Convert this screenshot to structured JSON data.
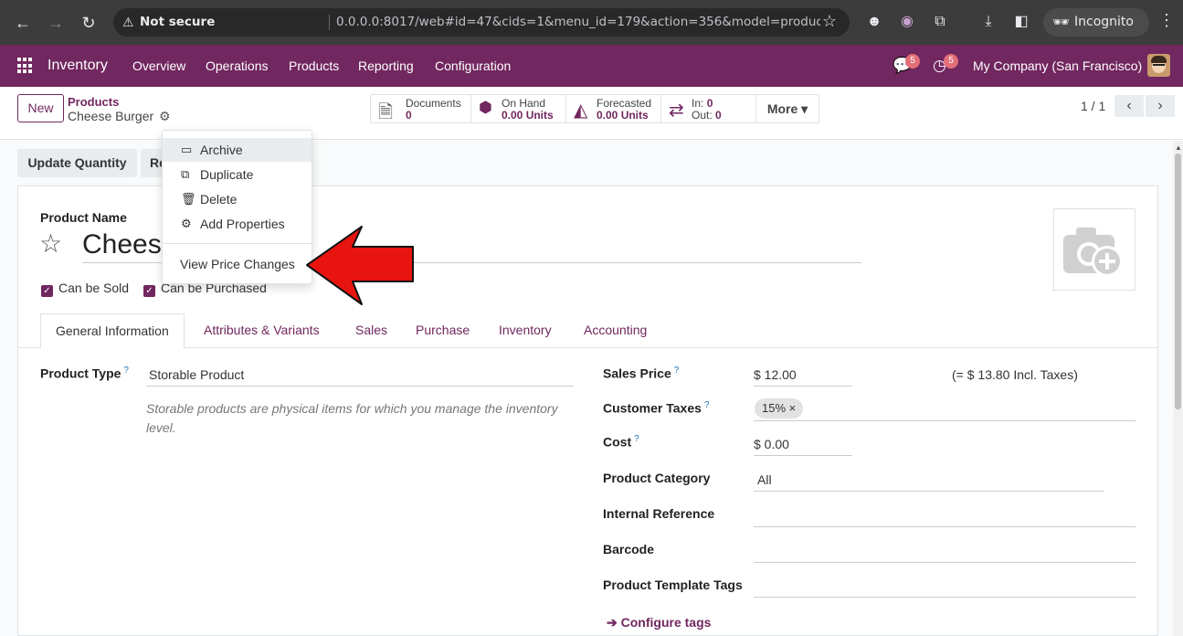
{
  "browser": {
    "security_label": "Not secure",
    "url": "0.0.0.0:8017/web#id=47&cids=1&menu_id=179&action=356&model=product.template&view_type=...",
    "incognito_label": "Incognito"
  },
  "navbar": {
    "app_name": "Inventory",
    "menus": [
      "Overview",
      "Operations",
      "Products",
      "Reporting",
      "Configuration"
    ],
    "messages_count": "5",
    "activities_count": "5",
    "company": "My Company (San Francisco)",
    "accent_color": "#71275f"
  },
  "control_panel": {
    "new_label": "New",
    "breadcrumb_parent": "Products",
    "breadcrumb_current": "Cheese Burger",
    "smart_buttons": [
      {
        "icon": "document-icon",
        "label": "Documents",
        "value": "0"
      },
      {
        "icon": "cubes-icon",
        "label": "On Hand",
        "value": "0.00 Units"
      },
      {
        "icon": "area-chart-icon",
        "label": "Forecasted",
        "value": "0.00 Units"
      },
      {
        "icon": "exchange-icon",
        "label_in": "In:",
        "value_in": "0",
        "label_out": "Out:",
        "value_out": "0"
      }
    ],
    "more_label": "More",
    "pager": "1 / 1"
  },
  "actions": {
    "update_quantity": "Update Quantity",
    "replenish_partial": "Re"
  },
  "dropdown": {
    "items": [
      {
        "icon": "archive-icon",
        "label": "Archive"
      },
      {
        "icon": "copy-icon",
        "label": "Duplicate"
      },
      {
        "icon": "trash-icon",
        "label": "Delete"
      },
      {
        "icon": "cogs-icon",
        "label": "Add Properties"
      }
    ],
    "extra_item": "View Price Changes"
  },
  "form": {
    "product_name_label": "Product Name",
    "product_name": "Cheese Burger",
    "can_be_sold": "Can be Sold",
    "can_be_purchased": "Can be Purchased",
    "tabs": [
      "General Information",
      "Attributes & Variants",
      "Sales",
      "Purchase",
      "Inventory",
      "Accounting"
    ],
    "product_type_label": "Product Type",
    "product_type": "Storable Product",
    "product_type_help": "Storable products are physical items for which you manage the inventory level.",
    "sales_price_label": "Sales Price",
    "sales_price": "$ 12.00",
    "sales_price_incl": "(= $ 13.80 Incl. Taxes)",
    "customer_taxes_label": "Customer Taxes",
    "customer_tax_tag": "15%",
    "cost_label": "Cost",
    "cost": "$ 0.00",
    "product_category_label": "Product Category",
    "product_category": "All",
    "internal_reference_label": "Internal Reference",
    "barcode_label": "Barcode",
    "template_tags_label": "Product Template Tags",
    "configure_tags": "Configure tags"
  }
}
